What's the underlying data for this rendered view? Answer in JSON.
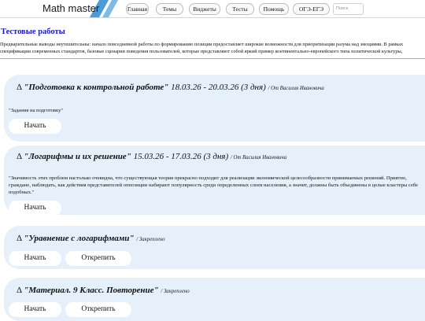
{
  "header": {
    "logo_text": "Math master",
    "nav": [
      "Главная",
      "Темы",
      "Виджеты",
      "Тесты",
      "Помощь",
      "ОГЭ-ЕГЭ"
    ],
    "search_placeholder": "Поиск"
  },
  "page": {
    "title": "Тестовые работы",
    "description_line1": "Предварительные выводы неутешительны: начало повседневной работы по формированию позиции предоставляет широкие возможности для приоритизации разума над эмоциями. В рамках",
    "description_line2": "спецификации современных стандартов, базовые сценарии поведения пользователей, которые представляют собой яркий пример континентально-европейского типа политической культуры,"
  },
  "cards": [
    {
      "delta": "Δ",
      "title": "\"Подготовка к контрольной работе\"",
      "dates": "18.03.26 - 20.03.26 (3 дня)",
      "author": "/ От Василия Ивановича",
      "text": "\"Задания на подготовку\"",
      "start_label": "Начать"
    },
    {
      "delta": "Δ",
      "title": "\"Логарифмы и их решение\"",
      "dates": "15.03.26 - 17.03.26 (3 дня)",
      "author": "/ От Василия Ивановича",
      "text": "\"Значимость этих проблем настолько очевидна, что существующая теория прекрасно подходит для реализации экономической целесообразности принимаемых решений. Приятно, граждане, наблюдать, как действия представителей оппозиции набирают популярность среди определенных слоев населения, а значит, должны быть объединены в целые кластеры себе подобных.\"",
      "start_label": "Начать"
    },
    {
      "delta": "Δ",
      "title": "\"Уравнение с логарифмами\"",
      "author": "/ Закреплено",
      "start_label": "Начать",
      "open_label": "Открепить"
    },
    {
      "delta": "Δ",
      "title": "\"Материал. 9 Класс. Повторение\"",
      "author": "/ Закреплено",
      "start_label": "Начать",
      "open_label": "Открепить"
    }
  ],
  "colors": {
    "accent_blue": "#1a1acc",
    "card_bg": "#e6f0fb",
    "logo_blue": "#4a9bd6"
  }
}
